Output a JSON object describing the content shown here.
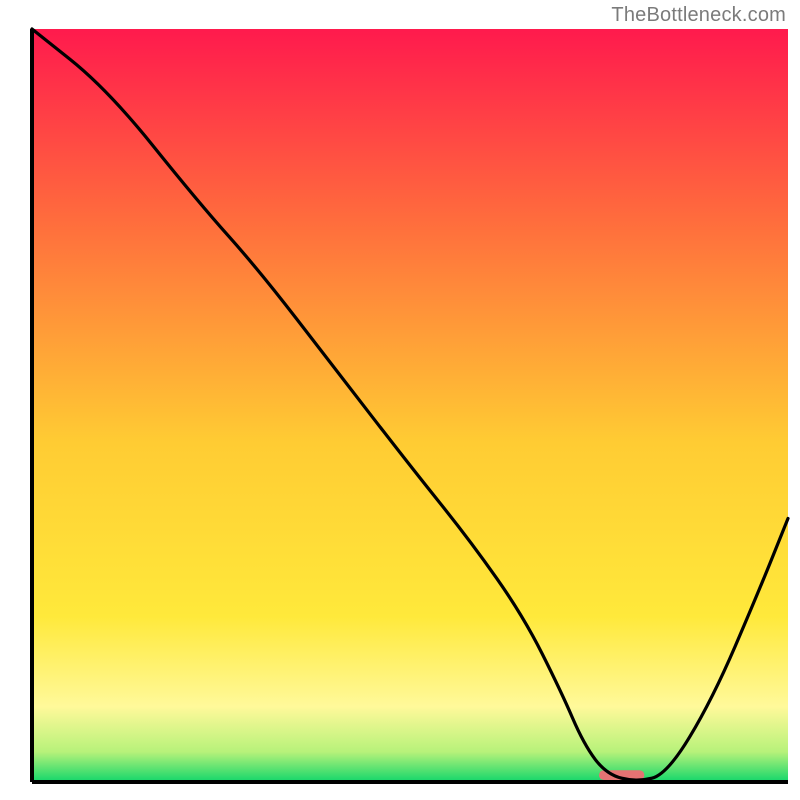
{
  "watermark": "TheBottleneck.com",
  "chart_data": {
    "type": "line",
    "title": "",
    "xlabel": "",
    "ylabel": "",
    "xlim": [
      0,
      100
    ],
    "ylim": [
      0,
      100
    ],
    "background_gradient": {
      "stops": [
        {
          "offset": 0,
          "color": "#ff1a4d"
        },
        {
          "offset": 25,
          "color": "#ff6b3d"
        },
        {
          "offset": 55,
          "color": "#ffcc33"
        },
        {
          "offset": 78,
          "color": "#ffe93b"
        },
        {
          "offset": 90,
          "color": "#fff99a"
        },
        {
          "offset": 96,
          "color": "#b7f27a"
        },
        {
          "offset": 100,
          "color": "#12d66b"
        }
      ]
    },
    "axes_color": "#000000",
    "series": [
      {
        "name": "bottleneck-curve",
        "color": "#000000",
        "x": [
          0,
          10,
          22,
          30,
          40,
          50,
          58,
          65,
          70,
          73,
          76,
          80,
          84,
          90,
          96,
          100
        ],
        "y": [
          100,
          92,
          77,
          68,
          55,
          42,
          32,
          22,
          12,
          5,
          1,
          0,
          1,
          11,
          25,
          35
        ]
      }
    ],
    "marker": {
      "name": "optimal-range-marker",
      "color": "#e57373",
      "x": 78,
      "width": 6,
      "height": 1.3
    }
  }
}
